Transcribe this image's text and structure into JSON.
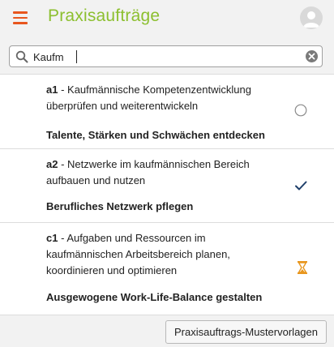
{
  "header": {
    "title": "Praxisaufträge",
    "menu_icon": "hamburger-menu-icon",
    "avatar_icon": "user-avatar-icon",
    "accent_color": "#e8561e",
    "title_color": "#8cbf2f"
  },
  "search": {
    "value": "Kaufm",
    "icon": "search-icon",
    "clear_icon": "clear-icon"
  },
  "items": [
    {
      "code": "a1",
      "separator": " - ",
      "description": "Kaufmännische Kompetenzentwicklung überprüfen und weiterentwickeln",
      "goal": "Talente, Stärken und Schwächen entdecken",
      "status": "open",
      "status_icon": "empty-circle-icon"
    },
    {
      "code": "a2",
      "separator": " - ",
      "description": "Netzwerke im kaufmännischen Bereich aufbauen und nutzen",
      "goal": "Berufliches Netzwerk pflegen",
      "status": "done",
      "status_icon": "checkmark-icon"
    },
    {
      "code": "c1",
      "separator": " - ",
      "description": "Aufgaben und Ressourcen im kaufmännischen Arbeitsbereich planen, koordinieren und optimieren",
      "goal": "Ausgewogene Work-Life-Balance gestalten",
      "status": "in-progress",
      "status_icon": "hourglass-icon"
    }
  ],
  "footer": {
    "templates_button": "Praxisauftrags-Mustervorlagen"
  }
}
